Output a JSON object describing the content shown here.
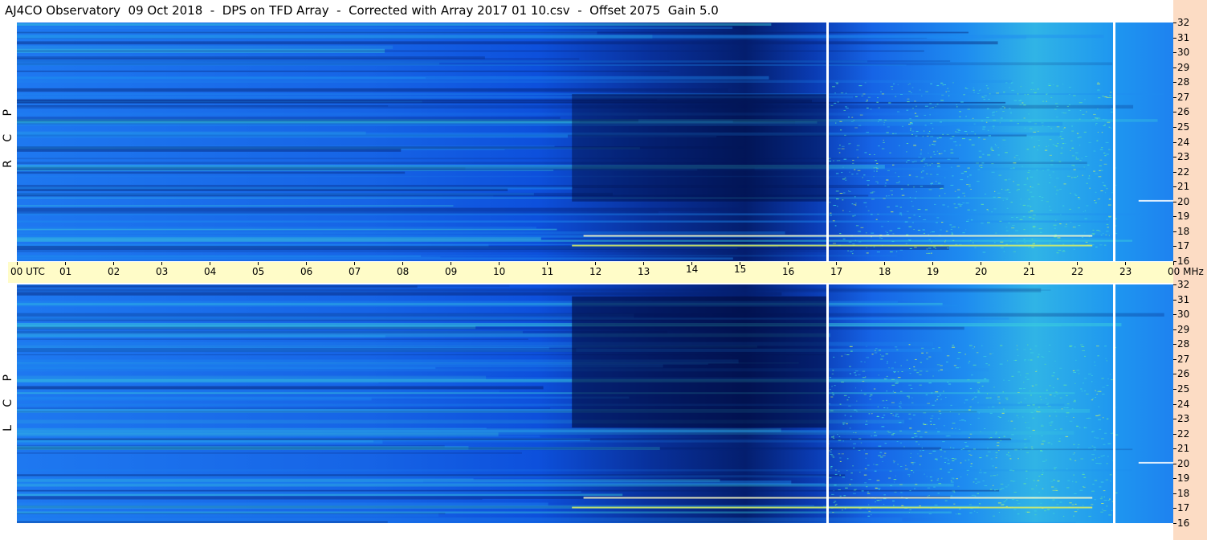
{
  "title": "AJ4CO Observatory  09 Oct 2018  -  DPS on TFD Array  -  Corrected with Array 2017 01 10.csv  -  Offset 2075  Gain 5.0",
  "colors": {
    "background": "#ffffff",
    "time_band": "#fffcc8",
    "frequency_strip": "#fcdcc4",
    "spectrogram_low": "#000a3c",
    "spectrogram_mid": "#0d50dc",
    "spectrogram_high": "#3cd2dc",
    "spectrogram_peak": "#ffffc8"
  },
  "chart_data": [
    {
      "type": "heatmap",
      "panel_label": "R C P",
      "x": [
        "00",
        "01",
        "02",
        "03",
        "04",
        "05",
        "06",
        "07",
        "08",
        "09",
        "10",
        "11",
        "12",
        "13",
        "14",
        "15",
        "16",
        "17",
        "18",
        "19",
        "20",
        "21",
        "22",
        "23",
        "00"
      ],
      "x_first_label": "00  UTC",
      "y_ticks": [
        32,
        31,
        30,
        29,
        28,
        27,
        26,
        25,
        24,
        23,
        22,
        21,
        20,
        19,
        18,
        17,
        16
      ],
      "y_unit_label": "MHz",
      "xlim": [
        0,
        24
      ],
      "ylim": [
        16,
        32
      ],
      "vertical_gaps_utc": [
        16.8,
        22.75
      ]
    },
    {
      "type": "heatmap",
      "panel_label": "L C P",
      "x": [
        "00",
        "01",
        "02",
        "03",
        "04",
        "05",
        "06",
        "07",
        "08",
        "09",
        "10",
        "11",
        "12",
        "13",
        "14",
        "15",
        "16",
        "17",
        "18",
        "19",
        "20",
        "21",
        "22",
        "23",
        "00"
      ],
      "x_first_label": "00  UTC",
      "y_ticks": [
        32,
        31,
        30,
        29,
        28,
        27,
        26,
        25,
        24,
        23,
        22,
        21,
        20,
        19,
        18,
        17,
        16
      ],
      "y_unit_label": "MHz",
      "xlim": [
        0,
        24
      ],
      "ylim": [
        16,
        32
      ],
      "vertical_gaps_utc": [
        16.8,
        22.75
      ]
    }
  ]
}
